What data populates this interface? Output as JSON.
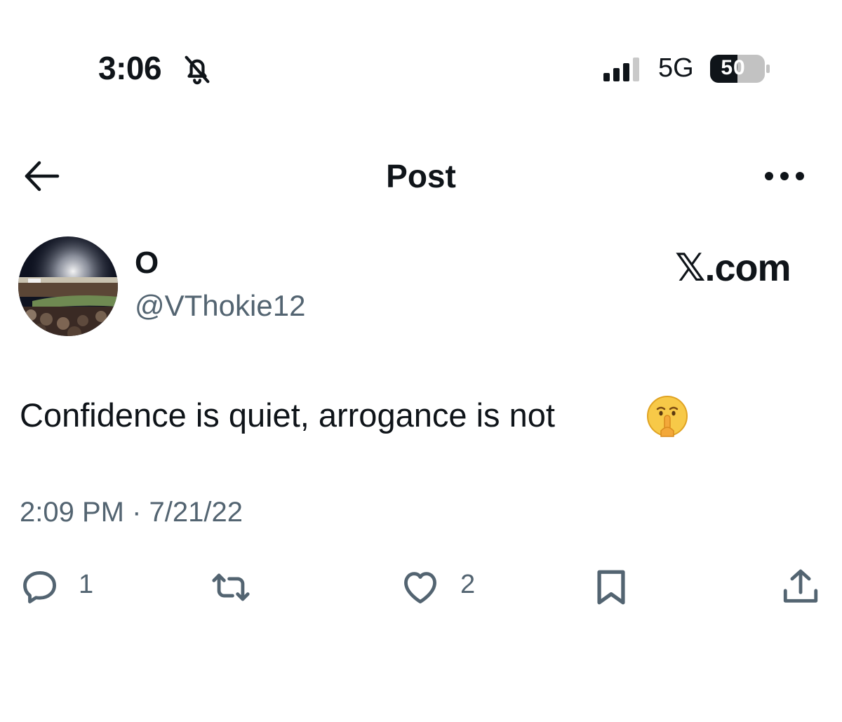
{
  "status_bar": {
    "time": "3:06",
    "network": "5G",
    "battery": "50",
    "icons": [
      "bell-slash-icon",
      "signal-icon",
      "battery-icon"
    ]
  },
  "header": {
    "title": "Post",
    "icons": [
      "back-arrow-icon",
      "more-icon"
    ]
  },
  "post": {
    "author": {
      "display_name": "O",
      "handle": "@VThokie12"
    },
    "brand": "𝕏.com",
    "text": "Confidence is quiet, arrogance is not",
    "emoji": "shushing-face-emoji",
    "timestamp": "2:09 PM · 7/21/22"
  },
  "actions": {
    "reply_count": "1",
    "like_count": "2",
    "icons": [
      "reply-icon",
      "repost-icon",
      "like-icon",
      "bookmark-icon",
      "share-icon"
    ]
  },
  "colors": {
    "text": "#0f1419",
    "secondary": "#536471",
    "background": "#ffffff"
  }
}
